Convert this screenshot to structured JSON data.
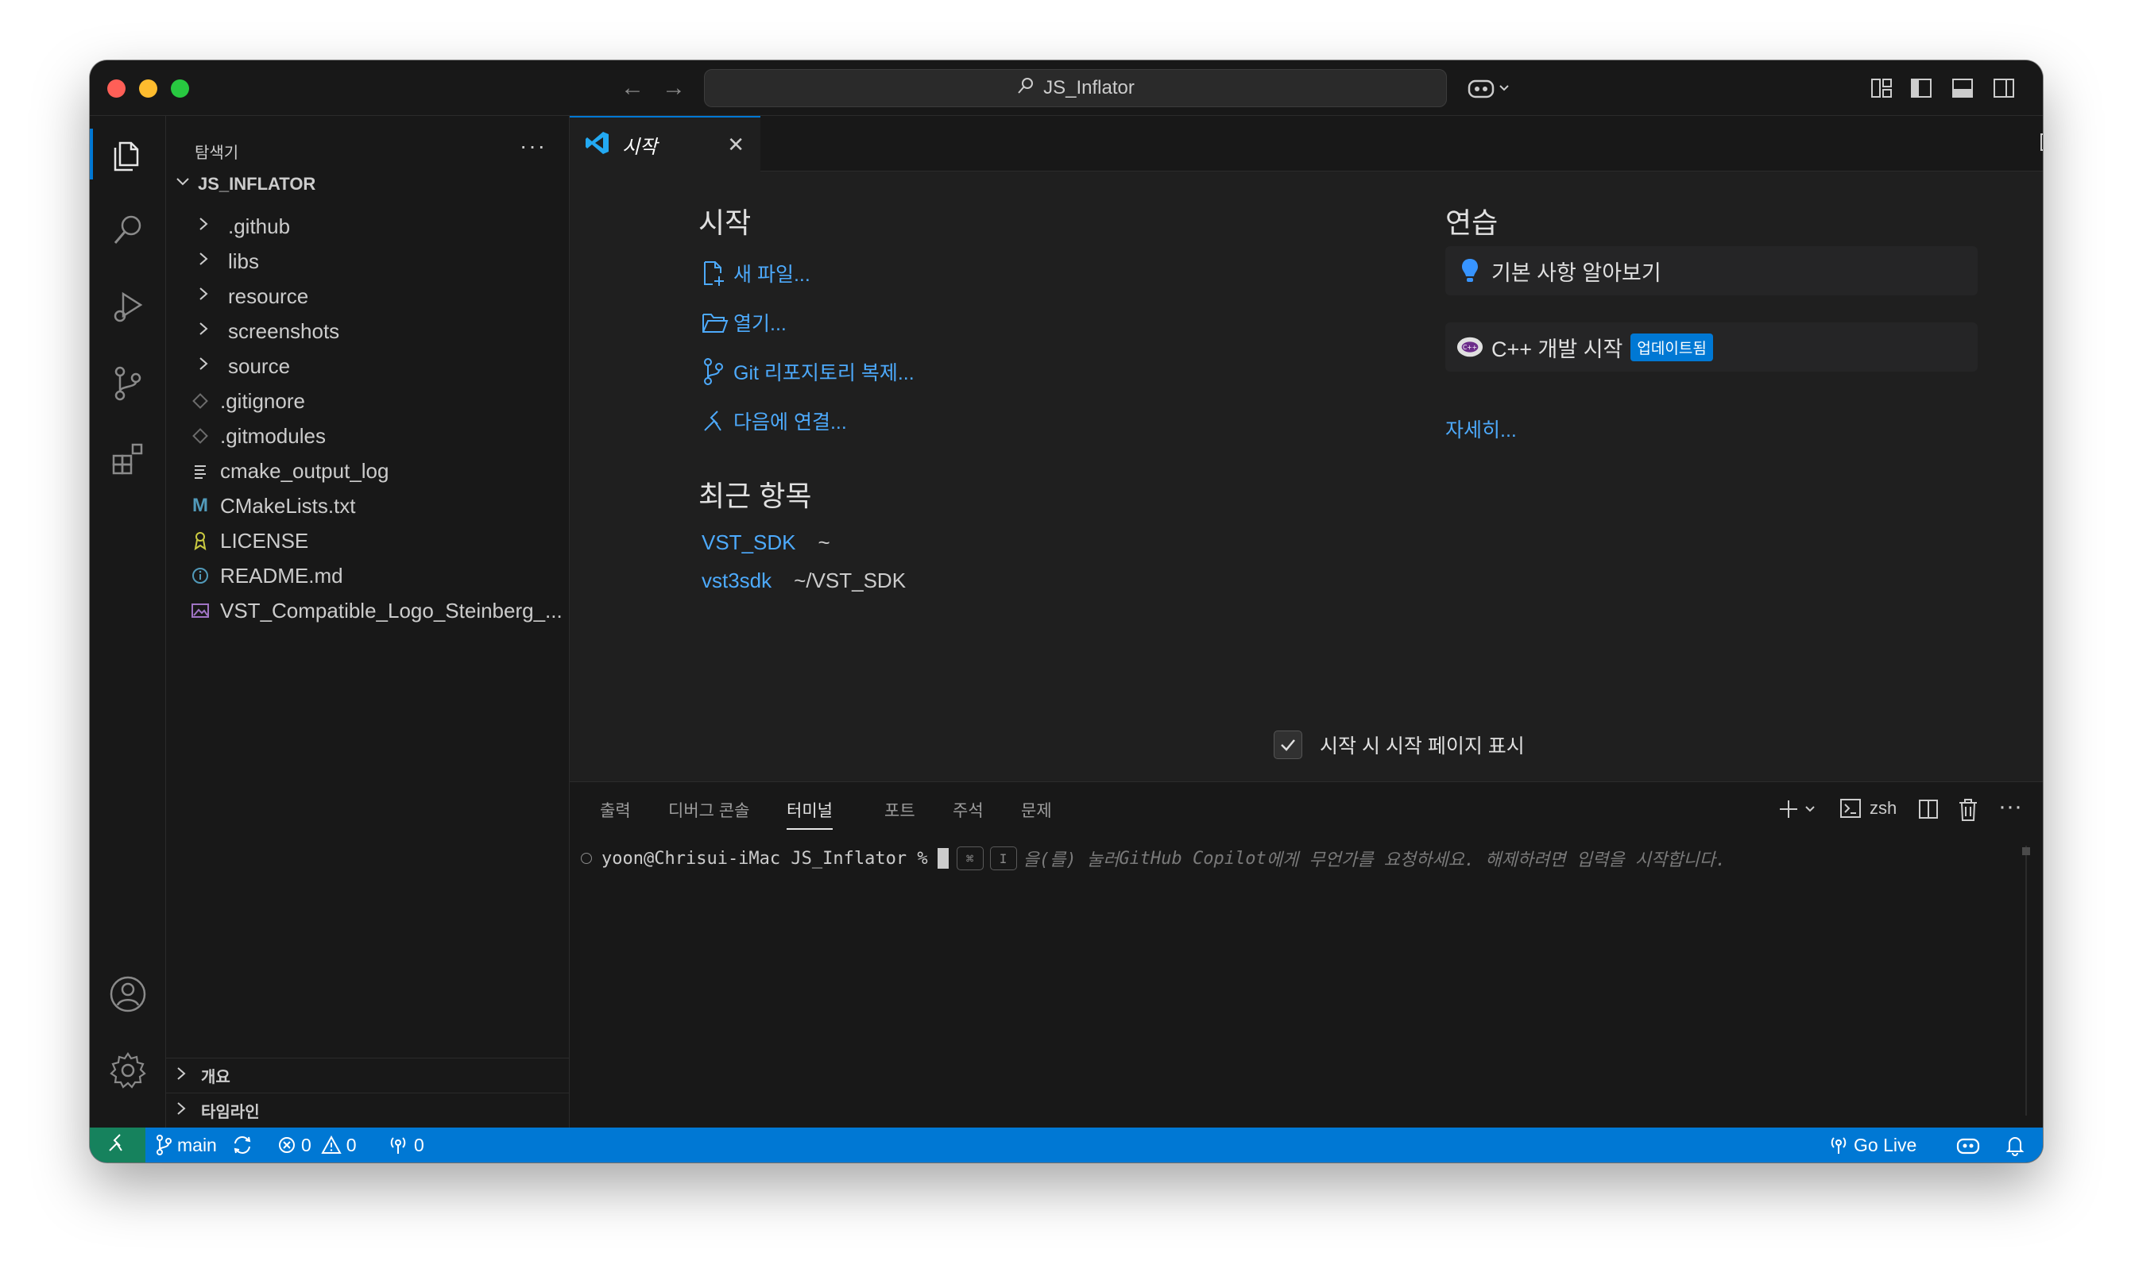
{
  "titlebar": {
    "search_text": "JS_Inflator"
  },
  "sidebar": {
    "header": "탐색기",
    "root": "JS_INFLATOR",
    "folders": [
      ".github",
      "libs",
      "resource",
      "screenshots",
      "source"
    ],
    "files": [
      {
        "name": ".gitignore",
        "icon": "git-file-icon",
        "color": "#6c6c6c"
      },
      {
        "name": ".gitmodules",
        "icon": "git-file-icon",
        "color": "#6c6c6c"
      },
      {
        "name": "cmake_output_log",
        "icon": "text-lines-icon",
        "color": "#cccccc"
      },
      {
        "name": "CMakeLists.txt",
        "icon": "m-letter-icon",
        "color": "#519aba"
      },
      {
        "name": "LICENSE",
        "icon": "license-icon",
        "color": "#cbcb41"
      },
      {
        "name": "README.md",
        "icon": "info-icon",
        "color": "#519aba"
      },
      {
        "name": "VST_Compatible_Logo_Steinberg_...",
        "icon": "image-icon",
        "color": "#a074c4"
      }
    ],
    "sections": [
      "개요",
      "타임라인"
    ]
  },
  "editor": {
    "tab_label": "시작",
    "start": {
      "heading": "시작",
      "actions": [
        {
          "label": "새 파일...",
          "icon": "new-file-icon"
        },
        {
          "label": "열기...",
          "icon": "folder-open-icon"
        },
        {
          "label": "Git 리포지토리 복제...",
          "icon": "git-branch-icon"
        },
        {
          "label": "다음에 연결...",
          "icon": "remote-connect-icon"
        }
      ]
    },
    "recent": {
      "heading": "최근 항목",
      "items": [
        {
          "name": "VST_SDK",
          "path": "~"
        },
        {
          "name": "vst3sdk",
          "path": "~/VST_SDK"
        }
      ]
    },
    "walkthroughs": {
      "heading": "연습",
      "items": [
        {
          "label": "기본 사항 알아보기",
          "badge": ""
        },
        {
          "label": "C++ 개발 시작",
          "badge": "업데이트됨"
        }
      ],
      "more": "자세히..."
    },
    "startup_checkbox": {
      "label": "시작 시 시작 페이지 표시",
      "checked": true
    }
  },
  "panel": {
    "tabs": [
      "출력",
      "디버그 콘솔",
      "터미널",
      "포트",
      "주석",
      "문제"
    ],
    "active_tab": "터미널",
    "shell": "zsh",
    "prompt": "yoon@Chrisui-iMac JS_Inflator %",
    "key1": "⌘",
    "key2": "I",
    "hint_a": "을(를) 눌러 ",
    "hint_b": "GitHub Copilot",
    "hint_c": "에게 무언가를 요청하세요. 해제하려면 입력을 시작합니다."
  },
  "statusbar": {
    "branch": "main",
    "errors": "0",
    "warnings": "0",
    "ports": "0",
    "go_live": "Go Live"
  },
  "colors": {
    "accent": "#0078d4",
    "link": "#4daafc",
    "remote": "#16825d"
  }
}
